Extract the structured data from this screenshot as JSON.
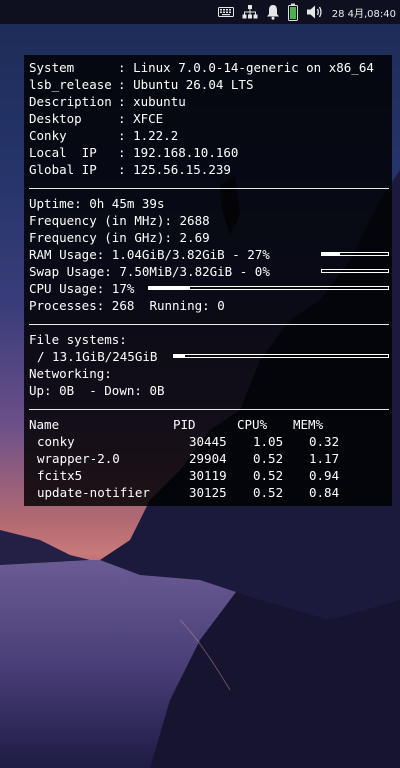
{
  "panel": {
    "clock": "28 4月,08:40",
    "icons": [
      "keyboard-icon",
      "network-icon",
      "bell-icon",
      "battery-icon",
      "volume-icon"
    ],
    "battery_color": "#4caf50"
  },
  "system": [
    {
      "label": "System",
      "value": "Linux 7.0.0-14-generic on x86_64"
    },
    {
      "label": "lsb_release",
      "value": "Ubuntu 26.04 LTS"
    },
    {
      "label": "Description",
      "value": "xubuntu"
    },
    {
      "label": "Desktop",
      "value": "XFCE"
    },
    {
      "label": "Conky",
      "value": "1.22.2"
    },
    {
      "label": "Local  IP",
      "value": "192.168.10.160"
    },
    {
      "label": "Global IP",
      "value": "125.56.15.239"
    }
  ],
  "stats": {
    "uptime_label": "Uptime:",
    "uptime": "0h 45m 39s",
    "freq_mhz_label": "Frequency (in MHz):",
    "freq_mhz": "2688",
    "freq_ghz_label": "Frequency (in GHz):",
    "freq_ghz": "2.69",
    "ram_label": "RAM Usage:",
    "ram": "1.04GiB/3.82GiB - 27%",
    "ram_fraction": 0.27,
    "swap_label": "Swap Usage:",
    "swap": "7.50MiB/3.82GiB - 0%",
    "swap_fraction": 0.0,
    "cpu_label": "CPU Usage:",
    "cpu": "17%",
    "cpu_fraction": 0.17,
    "processes_label": "Processes:",
    "processes": "268",
    "running_label": "Running:",
    "running": "0"
  },
  "fs": {
    "title": "File systems:",
    "root": "/ 13.1GiB/245GiB",
    "root_fraction": 0.053,
    "net_title": "Networking:",
    "up_label": "Up:",
    "up": "0B",
    "down_label": "- Down:",
    "down": "0B"
  },
  "processes": {
    "headers": [
      "Name",
      "PID",
      "CPU%",
      "MEM%"
    ],
    "rows": [
      [
        "conky",
        "30445",
        "1.05",
        "0.32"
      ],
      [
        "wrapper-2.0",
        "29904",
        "0.52",
        "1.17"
      ],
      [
        "fcitx5",
        "30119",
        "0.52",
        "0.94"
      ],
      [
        "update-notifier",
        "30125",
        "0.52",
        "0.84"
      ]
    ]
  }
}
